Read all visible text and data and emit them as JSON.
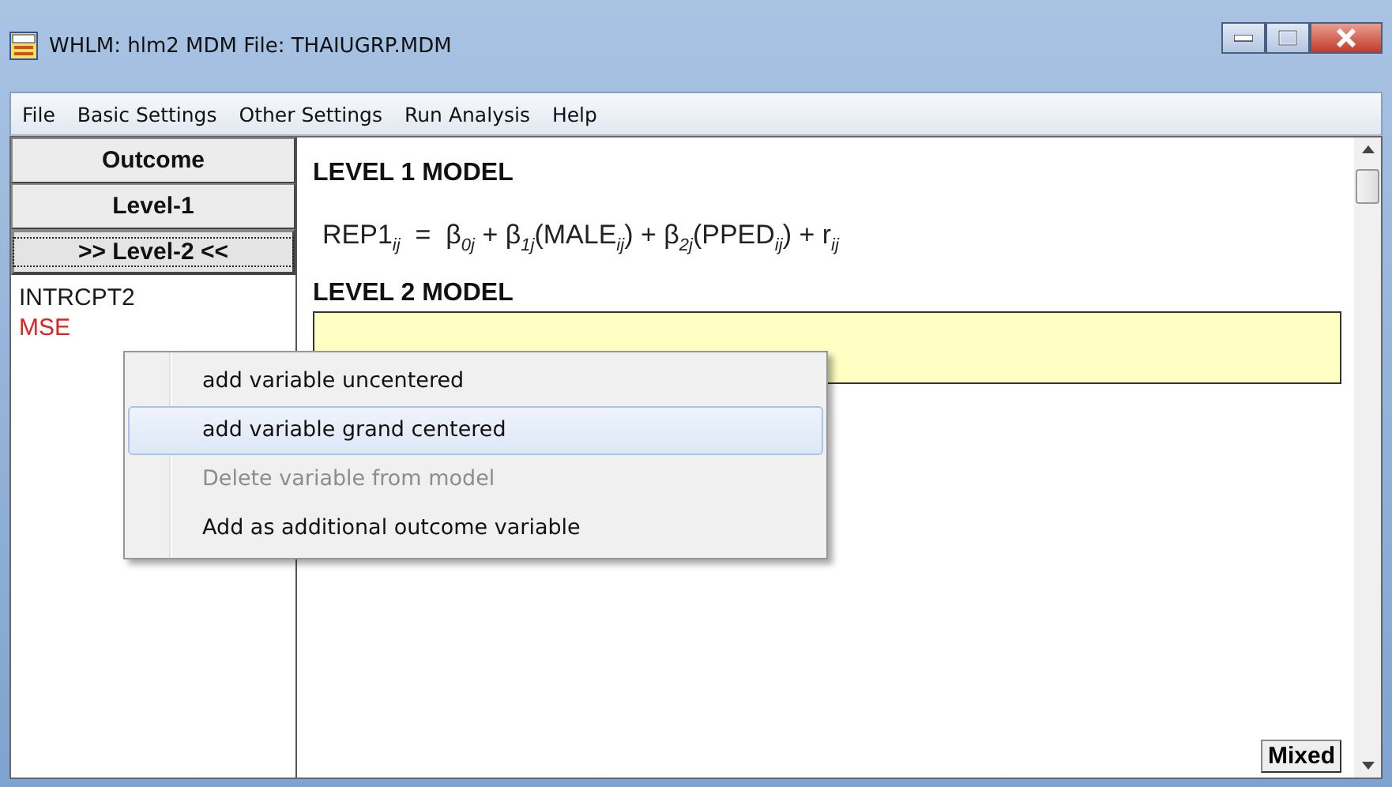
{
  "window": {
    "title": "WHLM: hlm2 MDM File: THAIUGRP.MDM"
  },
  "menu_bar": [
    "File",
    "Basic Settings",
    "Other Settings",
    "Run Analysis",
    "Help"
  ],
  "level_buttons": [
    {
      "label": "Outcome",
      "selected": false
    },
    {
      "label": "Level-1",
      "selected": false
    },
    {
      "label": ">> Level-2 <<",
      "selected": true
    }
  ],
  "variables": [
    {
      "name": "INTRCPT2",
      "color": "#1a1a1a"
    },
    {
      "name": "MSE",
      "color": "#e02020"
    }
  ],
  "model": {
    "level1_heading": "LEVEL 1 MODEL",
    "level1_equation": "REP1$_{ij}$  =  β$_{0j}$ + β$_{1j}$(MALE$_{ij}$) + β$_{2j}$(PPED$_{ij}$) + r$_{ij}$",
    "level2_heading": "LEVEL 2 MODEL"
  },
  "context_menu": [
    {
      "label": "add variable uncentered",
      "selected": false,
      "disabled": false
    },
    {
      "label": "add variable grand centered",
      "selected": true,
      "disabled": false
    },
    {
      "label": "Delete variable from model",
      "selected": false,
      "disabled": true
    },
    {
      "label": "Add as additional outcome variable",
      "selected": false,
      "disabled": false
    }
  ],
  "mode_button": "Mixed"
}
